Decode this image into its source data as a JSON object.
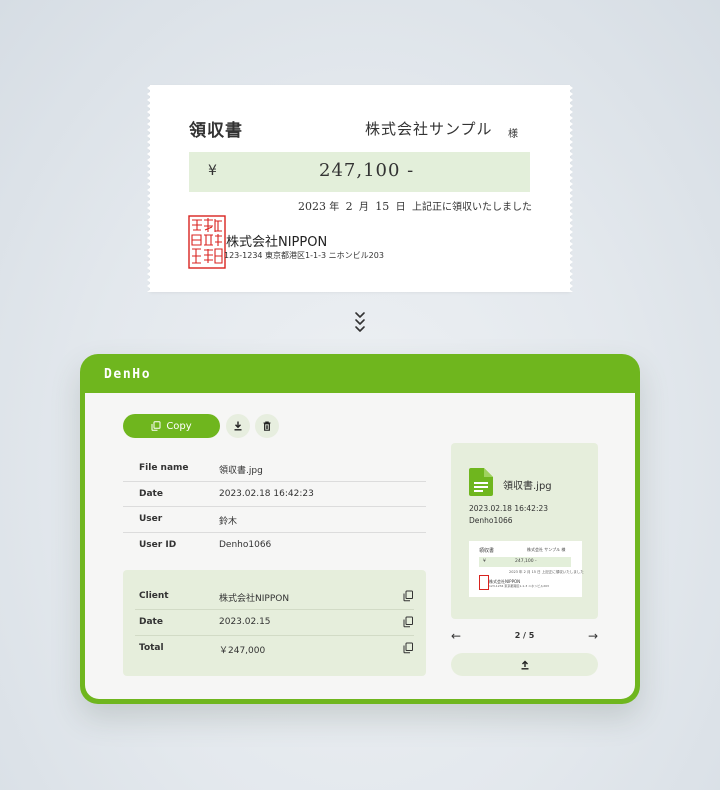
{
  "receipt": {
    "title": "領収書",
    "addressee": "株式会社サンプル",
    "honorific": "様",
    "currency_symbol": "¥",
    "amount": "247,100 -",
    "date": {
      "year": "2023",
      "year_suffix": "年",
      "month": "2",
      "month_suffix": "月",
      "day": "15",
      "day_suffix": "日",
      "note": "上記正に領収いたしました"
    },
    "issuer": "株式会社NIPPON",
    "address": "123-1234  東京都港区1-1-3 ニホンビル203",
    "seal_color": "#d8231f"
  },
  "app": {
    "brand": "DenHo",
    "accent_color": "#6fb61e",
    "toolbar": {
      "copy_label": "Copy"
    },
    "file_info": [
      {
        "key": "File name",
        "value": "領収書.jpg"
      },
      {
        "key": "Date",
        "value": "2023.02.18    16:42:23"
      },
      {
        "key": "User",
        "value": "鈴木"
      },
      {
        "key": "User ID",
        "value": "Denho1066"
      }
    ],
    "ocr_fields": [
      {
        "key": "Client",
        "value": "株式会社NIPPON"
      },
      {
        "key": "Date",
        "value": "2023.02.15"
      },
      {
        "key": "Total",
        "value": "￥247,000"
      }
    ],
    "preview": {
      "file_name": "領収書.jpg",
      "timestamp": "2023.02.18    16:42:23",
      "user_id": "Denho1066",
      "thumb": {
        "title": "領収書",
        "addressee": "株式会社 サンプル 様",
        "yen": "¥",
        "amount": "247,100 -",
        "date": "2023 年 2 月 15 日 上記正に領収いたしました",
        "issuer": "株式会社NIPPON",
        "address": "123-1234 東京都港区1-1-3 ニホンビル203"
      }
    },
    "pager": {
      "prev": "←",
      "page_text": "2 / 5",
      "next": "→"
    }
  }
}
